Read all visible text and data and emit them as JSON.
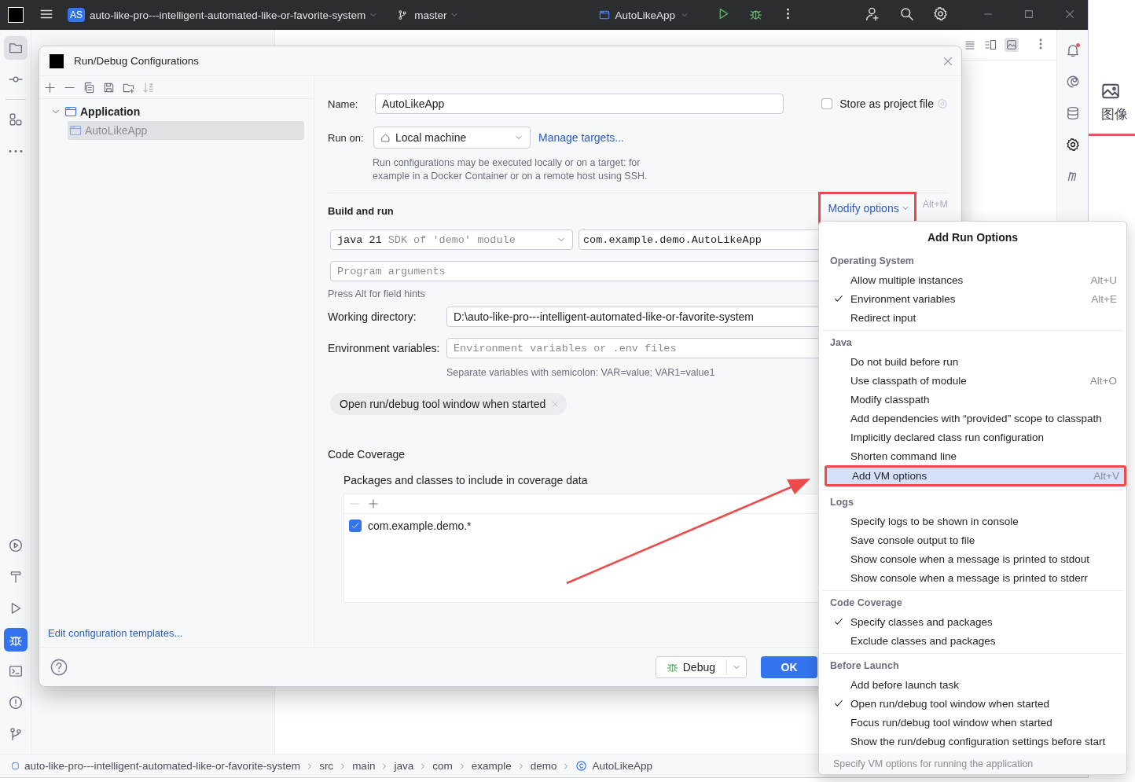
{
  "title_bar": {
    "project_badge": "AS",
    "project": "auto-like-pro---intelligent-automated-like-or-favorite-system",
    "branch": "master",
    "run_config": "AutoLikeApp"
  },
  "side_window": {
    "label": "图像"
  },
  "dialog": {
    "title": "Run/Debug Configurations",
    "tree": [
      {
        "label": "Application",
        "expanded": true,
        "selected": false,
        "children": [
          {
            "label": "AutoLikeApp",
            "selected": true
          }
        ]
      }
    ],
    "templates_link": "Edit configuration templates...",
    "name_label": "Name:",
    "name_value": "AutoLikeApp",
    "store_label": "Store as project file",
    "store_checked": false,
    "run_on_label": "Run on:",
    "run_on_value": "Local machine",
    "manage_link": "Manage targets...",
    "run_on_hint": "Run configurations may be executed locally or on a target: for example in a Docker Container or on a remote host using SSH.",
    "build_title": "Build and run",
    "modify_button": "Modify options",
    "modify_shortcut": "Alt+M",
    "jdk_value": "java 21",
    "jdk_hint": "SDK of 'demo' module",
    "main_class": "com.example.demo.AutoLikeApp",
    "args_placeholder": "Program arguments",
    "field_hint": "Press Alt for field hints",
    "workdir_label": "Working directory:",
    "workdir_value": "D:\\auto-like-pro---intelligent-automated-like-or-favorite-system",
    "env_label": "Environment variables:",
    "env_placeholder": "Environment variables or .env files",
    "env_hint": "Separate variables with semicolon: VAR=value; VAR1=value1",
    "tags": [
      "Open run/debug tool window when started"
    ],
    "coverage_title": "Code Coverage",
    "coverage_subtitle": "Packages and classes to include in coverage data",
    "coverage_items": [
      {
        "label": "com.example.demo.*",
        "checked": true
      }
    ],
    "debug_button": "Debug",
    "ok_button": "OK"
  },
  "popup": {
    "title": "Add Run Options",
    "sections": [
      {
        "title": "Operating System",
        "items": [
          {
            "label": "Allow multiple instances",
            "shortcut": "Alt+U",
            "checked": false,
            "selected": false
          },
          {
            "label": "Environment variables",
            "shortcut": "Alt+E",
            "checked": true,
            "selected": false
          },
          {
            "label": "Redirect input",
            "checked": false,
            "selected": false
          }
        ]
      },
      {
        "title": "Java",
        "items": [
          {
            "label": "Do not build before run",
            "checked": false,
            "selected": false
          },
          {
            "label": "Use classpath of module",
            "shortcut": "Alt+O",
            "checked": false,
            "selected": false
          },
          {
            "label": "Modify classpath",
            "checked": false,
            "selected": false
          },
          {
            "label": "Add dependencies with “provided” scope to classpath",
            "checked": false,
            "selected": false
          },
          {
            "label": "Implicitly declared class run configuration",
            "checked": false,
            "selected": false
          },
          {
            "label": "Shorten command line",
            "checked": false,
            "selected": false
          },
          {
            "label": "Add VM options",
            "shortcut": "Alt+V",
            "checked": false,
            "selected": true
          }
        ]
      },
      {
        "title": "Logs",
        "items": [
          {
            "label": "Specify logs to be shown in console",
            "checked": false,
            "selected": false
          },
          {
            "label": "Save console output to file",
            "checked": false,
            "selected": false
          },
          {
            "label": "Show console when a message is printed to stdout",
            "checked": false,
            "selected": false
          },
          {
            "label": "Show console when a message is printed to stderr",
            "checked": false,
            "selected": false
          }
        ]
      },
      {
        "title": "Code Coverage",
        "items": [
          {
            "label": "Specify classes and packages",
            "checked": true,
            "selected": false
          },
          {
            "label": "Exclude classes and packages",
            "checked": false,
            "selected": false
          }
        ]
      },
      {
        "title": "Before Launch",
        "items": [
          {
            "label": "Add before launch task",
            "checked": false,
            "selected": false
          },
          {
            "label": "Open run/debug tool window when started",
            "checked": true,
            "selected": false
          },
          {
            "label": "Focus run/debug tool window when started",
            "checked": false,
            "selected": false
          },
          {
            "label": "Show the run/debug configuration settings before start",
            "checked": false,
            "selected": false
          }
        ]
      }
    ],
    "footer": "Specify VM options for running the application"
  },
  "breadcrumbs": [
    "auto-like-pro---intelligent-automated-like-or-favorite-system",
    "src",
    "main",
    "java",
    "com",
    "example",
    "demo",
    "AutoLikeApp"
  ]
}
